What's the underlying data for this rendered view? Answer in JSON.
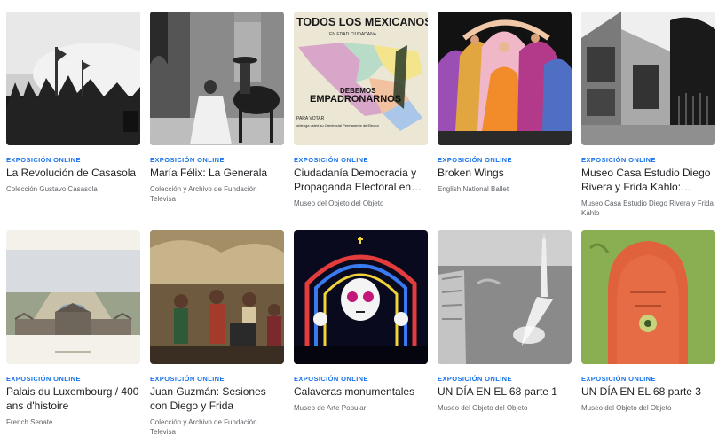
{
  "cards": [
    {
      "kicker": "EXPOSICIÓN ONLINE",
      "title": "La Revolución de Casasola",
      "subtitle": "Colección Gustavo Casasola"
    },
    {
      "kicker": "EXPOSICIÓN ONLINE",
      "title": "María Félix: La Generala",
      "subtitle": "Colección y Archivo de Fundación Televisa"
    },
    {
      "kicker": "EXPOSICIÓN ONLINE",
      "title": "Ciudadanía Democracia y Propaganda Electoral en…",
      "subtitle": "Museo del Objeto del Objeto",
      "map_text": {
        "headline": "TODOS LOS MEXICANOS",
        "sub": "EN EDAD CIUDADANA",
        "banner1": "DEBEMOS",
        "banner2": "EMPADRONARNOS",
        "small1": "PARA VOTAR",
        "small2": "obtenga usted su Credencial Permanente de Elector"
      }
    },
    {
      "kicker": "EXPOSICIÓN ONLINE",
      "title": "Broken Wings",
      "subtitle": "English National Ballet"
    },
    {
      "kicker": "EXPOSICIÓN ONLINE",
      "title": "Museo Casa Estudio Diego Rivera y Frida Kahlo:…",
      "subtitle": "Museo Casa Estudio Diego Rivera y Frida Kahlo"
    },
    {
      "kicker": "EXPOSICIÓN ONLINE",
      "title": "Palais du Luxembourg / 400 ans d'histoire",
      "subtitle": "French Senate"
    },
    {
      "kicker": "EXPOSICIÓN ONLINE",
      "title": "Juan Guzmán: Sesiones con Diego y Frida",
      "subtitle": "Colección y Archivo de Fundación Televisa"
    },
    {
      "kicker": "EXPOSICIÓN ONLINE",
      "title": "Calaveras monumentales",
      "subtitle": "Museo de Arte Popular"
    },
    {
      "kicker": "EXPOSICIÓN ONLINE",
      "title": "UN DÍA EN EL 68 parte 1",
      "subtitle": "Museo del Objeto del Objeto"
    },
    {
      "kicker": "EXPOSICIÓN ONLINE",
      "title": "UN DÍA EN EL 68 parte 3",
      "subtitle": "Museo del Objeto del Objeto"
    }
  ],
  "colors": {
    "kicker": "#1a73e8",
    "title": "#202124",
    "subtitle": "#5f6368"
  }
}
